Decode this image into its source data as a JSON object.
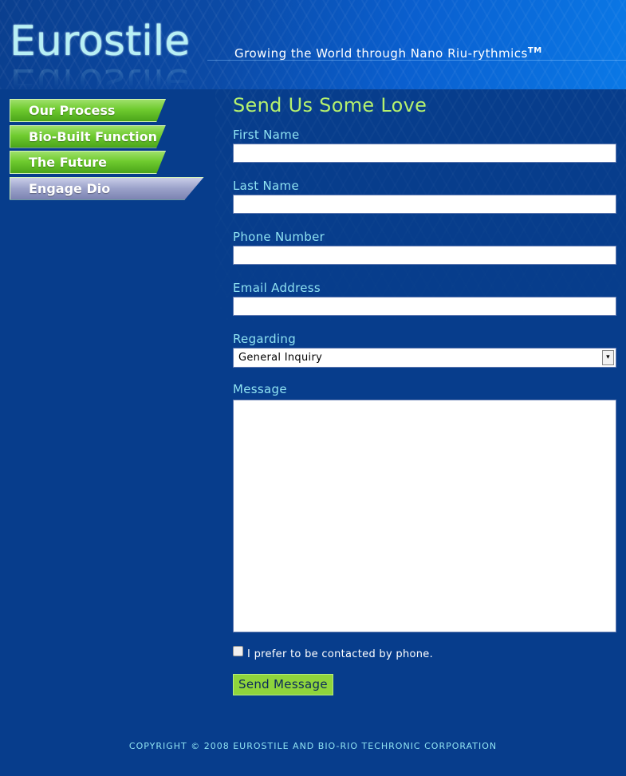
{
  "header": {
    "logo": "Eurostile",
    "tagline": "Growing the World through Nano Riu-rythmics",
    "trademark": "TM"
  },
  "nav": {
    "items": [
      {
        "label": "Our Process",
        "state": "default"
      },
      {
        "label": "Bio-Built Function",
        "state": "default"
      },
      {
        "label": "The Future",
        "state": "default"
      },
      {
        "label": "Engage Dio",
        "state": "active"
      }
    ]
  },
  "form": {
    "title": "Send Us Some Love",
    "fields": {
      "first_name": {
        "label": "First Name",
        "value": ""
      },
      "last_name": {
        "label": "Last Name",
        "value": ""
      },
      "phone": {
        "label": "Phone Number",
        "value": ""
      },
      "email": {
        "label": "Email Address",
        "value": ""
      },
      "regarding": {
        "label": "Regarding",
        "value": "General Inquiry"
      },
      "message": {
        "label": "Message",
        "value": ""
      }
    },
    "checkbox_label": "I prefer to be contacted by phone.",
    "checkbox_checked": false,
    "submit_label": "Send Message"
  },
  "footer": {
    "copyright": "COPYRIGHT © 2008 EUROSTILE AND BIO-RIO TECHRONIC CORPORATION"
  },
  "colors": {
    "page_background": "#073d8c",
    "title_green": "#b4f06e",
    "label_cyan": "#8fe2f2",
    "nav_green": "#6fcb2f",
    "nav_active": "#9aa1c9",
    "button_green": "#8fd53c"
  }
}
